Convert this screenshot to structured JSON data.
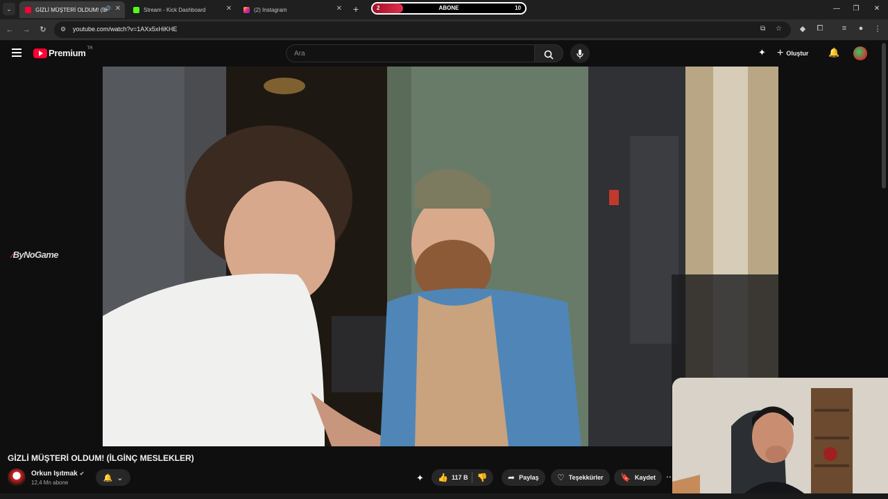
{
  "browser": {
    "tabs": [
      {
        "title": "GİZLİ MÜŞTERİ OLDUM! (İL",
        "active": true,
        "favicon_color": "#ff0033"
      },
      {
        "title": "Stream - Kick Dashboard",
        "active": false,
        "favicon_color": "#53fc18"
      },
      {
        "title": "(2) Instagram",
        "active": false,
        "favicon_color": "#e1306c"
      }
    ],
    "url": "youtube.com/watch?v=1AXx5xHiKHE"
  },
  "abone_goal": {
    "label": "ABONE",
    "current": "2",
    "target": "10",
    "progress": 0.2
  },
  "youtube": {
    "logo_text": "Premium",
    "logo_region": "TR",
    "search_placeholder": "Ara",
    "create_label": "Oluştur"
  },
  "overlay": {
    "watermark": "ByNoGame"
  },
  "video": {
    "title": "GİZLİ MÜŞTERİ OLDUM! (İLGİNÇ MESLEKLER)",
    "channel": "Orkun Işıtmak",
    "subscribers": "12,4 Mn abone",
    "likes": "117 B",
    "share_label": "Paylaş",
    "thanks_label": "Teşekkürler",
    "save_label": "Kaydet"
  },
  "colors": {
    "brand": "#ff0033",
    "background": "#0f0f0f",
    "pill": "#272727"
  }
}
